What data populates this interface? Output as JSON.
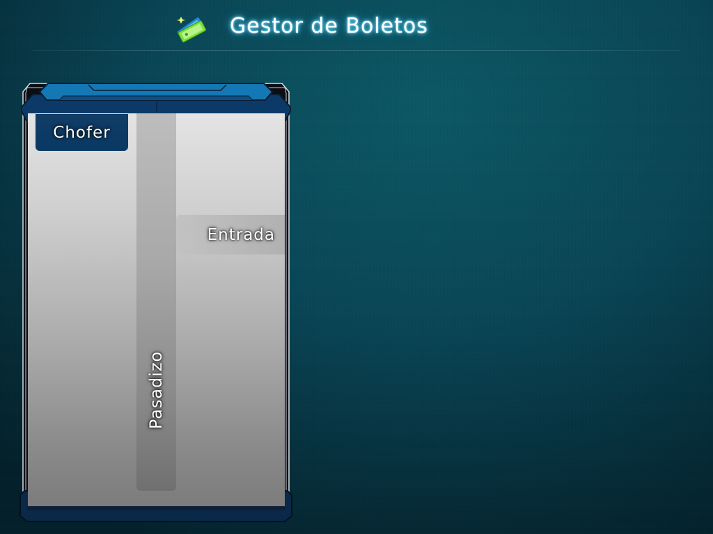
{
  "app": {
    "title": "Gestor de Boletos",
    "icon": "ticket-icon"
  },
  "bus_layout": {
    "driver_label": "Chofer",
    "entrance_label": "Entrada",
    "aisle_label": "Pasadizo"
  },
  "colors": {
    "background": "#094656",
    "title_glow": "#2bb6e8",
    "frame_blue": "#0d4f86",
    "frame_dark": "#0a2848",
    "driver_seat": "#0b3a64"
  }
}
